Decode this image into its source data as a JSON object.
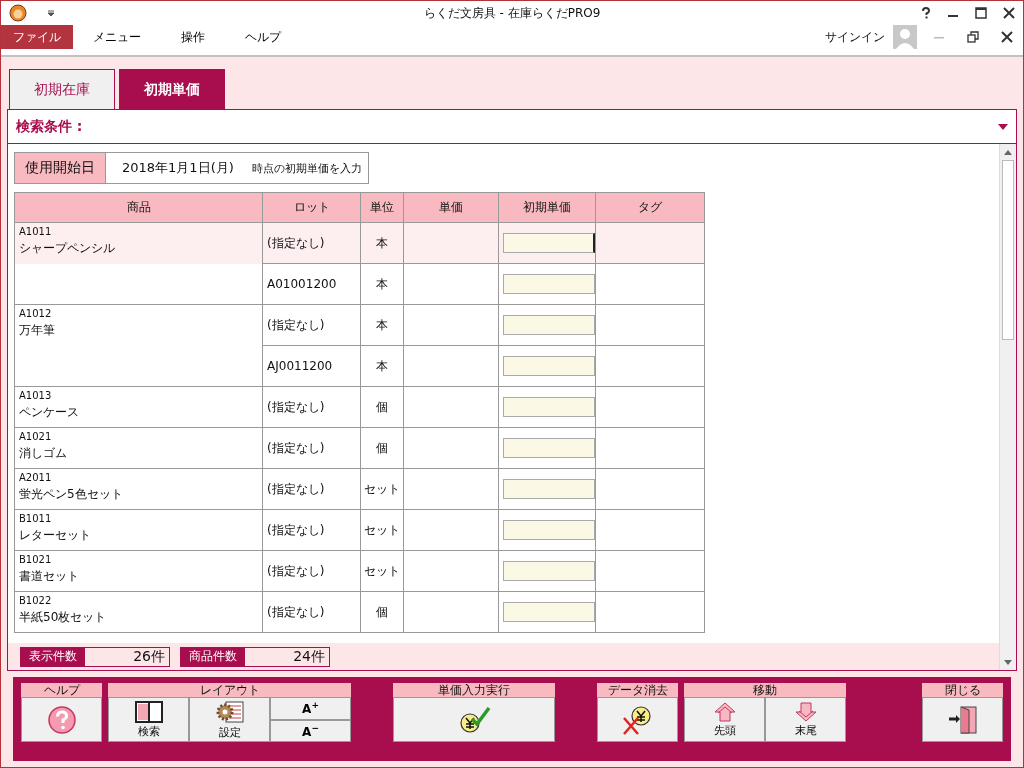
{
  "window": {
    "title": "らくだ文房具 - 在庫らくだPRO9"
  },
  "menu": [
    {
      "label": "ファイル",
      "kind": "file"
    },
    {
      "label": "メニュー",
      "kind": "menu"
    },
    {
      "label": "操作",
      "kind": "menu"
    },
    {
      "label": "ヘルプ",
      "kind": "menu"
    }
  ],
  "sign_in": "サインイン",
  "tabs": [
    {
      "label": "初期在庫",
      "selected": false
    },
    {
      "label": "初期単価",
      "selected": true
    }
  ],
  "search_condition": {
    "label": "検索条件 :"
  },
  "start_date": {
    "label": "使用開始日",
    "value": "2018年1月1日(月)",
    "note": "時点の初期単価を入力"
  },
  "table": {
    "columns": [
      "商品",
      "ロット",
      "単位",
      "単価",
      "初期単価",
      "タグ"
    ],
    "rows": [
      {
        "code": "A1011",
        "name": "シャープペンシル",
        "lots": [
          {
            "lot": "(指定なし)",
            "unit": "本",
            "selected": true,
            "focused": true
          },
          {
            "lot": "A01001200",
            "unit": "本",
            "selected": false,
            "focused": false
          }
        ]
      },
      {
        "code": "A1012",
        "name": "万年筆",
        "lots": [
          {
            "lot": "(指定なし)",
            "unit": "本",
            "selected": false,
            "focused": false
          },
          {
            "lot": "AJ0011200",
            "unit": "本",
            "selected": false,
            "focused": false
          }
        ]
      },
      {
        "code": "A1013",
        "name": "ペンケース",
        "lots": [
          {
            "lot": "(指定なし)",
            "unit": "個",
            "selected": false,
            "focused": false
          }
        ]
      },
      {
        "code": "A1021",
        "name": "消しゴム",
        "lots": [
          {
            "lot": "(指定なし)",
            "unit": "個",
            "selected": false,
            "focused": false
          }
        ]
      },
      {
        "code": "A2011",
        "name": "蛍光ペン5色セット",
        "lots": [
          {
            "lot": "(指定なし)",
            "unit": "セット",
            "selected": false,
            "focused": false
          }
        ]
      },
      {
        "code": "B1011",
        "name": "レターセット",
        "lots": [
          {
            "lot": "(指定なし)",
            "unit": "セット",
            "selected": false,
            "focused": false
          }
        ]
      },
      {
        "code": "B1021",
        "name": "書道セット",
        "lots": [
          {
            "lot": "(指定なし)",
            "unit": "セット",
            "selected": false,
            "focused": false
          }
        ]
      },
      {
        "code": "B1022",
        "name": "半紙50枚セット",
        "lots": [
          {
            "lot": "(指定なし)",
            "unit": "個",
            "selected": false,
            "focused": false
          }
        ]
      }
    ]
  },
  "counts": [
    {
      "label": "表示件数",
      "value": "26件"
    },
    {
      "label": "商品件数",
      "value": "24件"
    }
  ],
  "toolbar": [
    {
      "label": "ヘルプ",
      "buttons": [
        {
          "kind": "help"
        }
      ]
    },
    {
      "label": "レイアウト",
      "buttons": [
        {
          "kind": "search",
          "label": "検索"
        },
        {
          "kind": "settings",
          "label": "設定"
        },
        {
          "kind": "font",
          "labels": [
            "A$^{+}$",
            "A$^{−}$"
          ]
        }
      ]
    },
    {
      "label": "単価入力実行",
      "buttons": [
        {
          "kind": "execute"
        }
      ]
    },
    {
      "label": "データ消去",
      "buttons": [
        {
          "kind": "delete"
        }
      ]
    },
    {
      "label": "移動",
      "buttons": [
        {
          "kind": "first",
          "label": "先頭"
        },
        {
          "kind": "last",
          "label": "末尾"
        }
      ]
    },
    {
      "label": "閉じる",
      "buttons": [
        {
          "kind": "close"
        }
      ]
    }
  ]
}
